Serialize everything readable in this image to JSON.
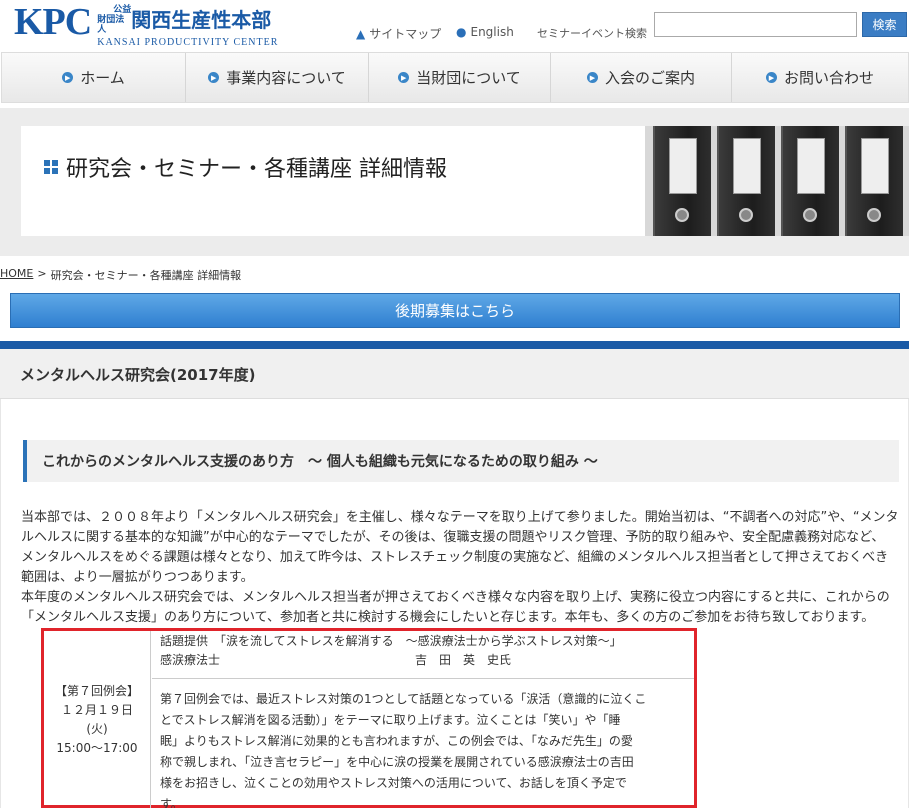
{
  "header": {
    "logo_mark": "KPC",
    "logo_small_1": "公益",
    "logo_small_2": "財団法人",
    "logo_name": "関西生産性本部",
    "logo_en": "KANSAI PRODUCTIVITY CENTER",
    "sitemap_label": "サイトマップ",
    "english_label": "English",
    "seminar_search_label": "セミナーイベント検索",
    "search_value": "",
    "search_button": "検索"
  },
  "nav": {
    "items": [
      {
        "label": "ホーム"
      },
      {
        "label": "事業内容について"
      },
      {
        "label": "当財団について"
      },
      {
        "label": "入会のご案内"
      },
      {
        "label": "お問い合わせ"
      }
    ]
  },
  "hero": {
    "title": "研究会・セミナー・各種講座 詳細情報"
  },
  "breadcrumb": {
    "home": "HOME",
    "separator": ">",
    "current": "研究会・セミナー・各種講座 詳細情報"
  },
  "recruit_button": "後期募集はこちら",
  "section": {
    "title": "メンタルヘルス研究会(2017年度)",
    "subtitle": "これからのメンタルヘルス支援のあり方　～ 個人も組織も元気になるための取り組み ～",
    "intro_lines": [
      "当本部では、２００８年より「メンタルヘルス研究会」を主催し、様々なテーマを取り上げて参りました。開始当初は、“不調者への対応”や、“メンタ",
      "ルヘルスに関する基本的な知識”が中心的なテーマでしたが、その後は、復職支援の問題やリスク管理、予防的取り組みや、安全配慮義務対応など、",
      "メンタルヘルスをめぐる課題は様々となり、加えて昨今は、ストレスチェック制度の実施など、組織のメンタルヘルス担当者として押さえておくべき",
      "範囲は、より一層拡がりつつあります。",
      "本年度のメンタルヘルス研究会では、メンタルヘルス担当者が押さえておくべき様々な内容を取り上げ、実務に役立つ内容にすると共に、これからの",
      "「メンタルヘルス支援」のあり方について、参加者と共に検討する機会にしたいと存じます。本年も、多くの方のご参加をお待ち致しております。"
    ]
  },
  "session": {
    "number": "【第７回例会】",
    "date": "１２月１９日",
    "weekday": "(火)",
    "time": "15:00～17:00",
    "topic": "話題提供　「涙を流してストレスを解消する　～感涙療法士から学ぶストレス対策～」",
    "speaker_role": "感涙療法士",
    "speaker_name": "吉　田　英　史氏",
    "description_lines": [
      "第７回例会では、最近ストレス対策の1つとして話題となっている「涙活（意識的に泣くこ",
      "とでストレス解消を図る活動）」をテーマに取り上げます。泣くことは「笑い」や「睡",
      "眠」よりもストレス解消に効果的とも言われますが、この例会では、「なみだ先生」の愛",
      "称で親しまれ、「泣き言セラピー」を中心に涙の授業を展開されている感涙療法士の吉田",
      "様をお招きし、泣くことの効用やストレス対策への活用について、お話しを頂く予定で",
      "す。"
    ]
  },
  "colors": {
    "brand_blue": "#1a5aa6",
    "highlight_red": "#e0242b"
  }
}
